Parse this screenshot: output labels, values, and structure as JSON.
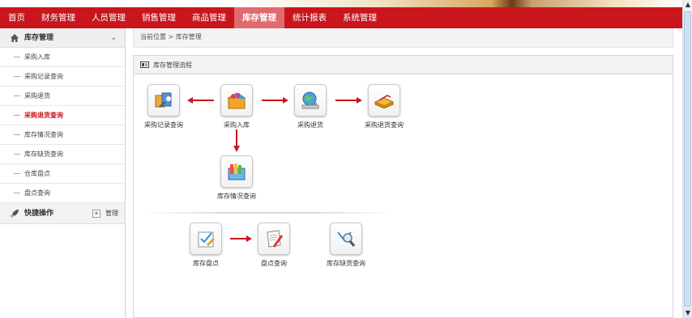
{
  "nav": {
    "items": [
      "首页",
      "财务管理",
      "人员管理",
      "销售管理",
      "商品管理",
      "库存管理",
      "统计报表",
      "系统管理"
    ],
    "active_index": 5
  },
  "sidebar": {
    "section_title": "库存管理",
    "items": [
      "采购入库",
      "采购记录查询",
      "采购退货",
      "采购退货查询",
      "库存情况查询",
      "库存缺货查询",
      "仓库盘点",
      "盘点查询"
    ],
    "active_index": 3,
    "quick_title": "快捷操作",
    "manage_label": "管理"
  },
  "breadcrumb": {
    "text": "当前位置 > 库存管理"
  },
  "panel": {
    "title": "库存管理流程",
    "nodes": {
      "purchase_record": "采购记录查询",
      "purchase_in": "采购入库",
      "purchase_return": "采购退货",
      "purchase_return_query": "采购退货查询",
      "stock_query": "库存情况查询",
      "inventory_check": "库存盘点",
      "check_query": "盘点查询",
      "shortage_query": "库存缺货查询"
    }
  },
  "colors": {
    "nav_bg": "#c9161c",
    "nav_active": "#e06a6e",
    "accent": "#c9161c"
  }
}
